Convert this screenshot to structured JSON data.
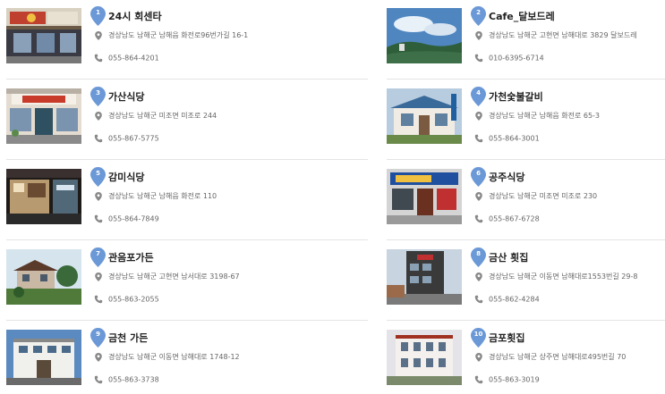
{
  "colors": {
    "pin": "#6b98d6",
    "icon": "#888888",
    "divider": "#e4e4e4"
  },
  "restaurants": [
    {
      "num": "1",
      "name": "24시 회센타",
      "address": "경상남도 남해군 남해읍 화전로96번가길 16-1",
      "phone": "055-864-4201",
      "photo": "storefront-sign"
    },
    {
      "num": "2",
      "name": "Cafe_달보드레",
      "address": "경상남도 남해군 고현면 남해대로 3829 달보드레",
      "phone": "010-6395-6714",
      "photo": "sky-hill"
    },
    {
      "num": "3",
      "name": "가산식당",
      "address": "경상남도 남해군 미조면 미조로 244",
      "phone": "055-867-5775",
      "photo": "restaurant-front"
    },
    {
      "num": "4",
      "name": "가천숯불갈비",
      "address": "경상남도 남해군 남해읍 화전로 65-3",
      "phone": "055-864-3001",
      "photo": "house-blue-roof"
    },
    {
      "num": "5",
      "name": "감미식당",
      "address": "경상남도 남해군 남해읍 화전로 110",
      "phone": "055-864-7849",
      "photo": "night-shop"
    },
    {
      "num": "6",
      "name": "공주식당",
      "address": "경상남도 남해군 미조면 미조로 230",
      "phone": "055-867-6728",
      "photo": "blue-sign-shop"
    },
    {
      "num": "7",
      "name": "관음포가든",
      "address": "경상남도 남해군 고현면 남서대로 3198-67",
      "phone": "055-863-2055",
      "photo": "garden-house"
    },
    {
      "num": "8",
      "name": "금산 횟집",
      "address": "경상남도 남해군 이동면 남해대로1553번길 29-8",
      "phone": "055-862-4284",
      "photo": "tall-building"
    },
    {
      "num": "9",
      "name": "금천 가든",
      "address": "경상남도 남해군 이동면 남해대로 1748-12",
      "phone": "055-863-3738",
      "photo": "white-building"
    },
    {
      "num": "10",
      "name": "금포횟집",
      "address": "경상남도 남해군 상주면 남해대로495번길 70",
      "phone": "055-863-3019",
      "photo": "villa"
    }
  ]
}
